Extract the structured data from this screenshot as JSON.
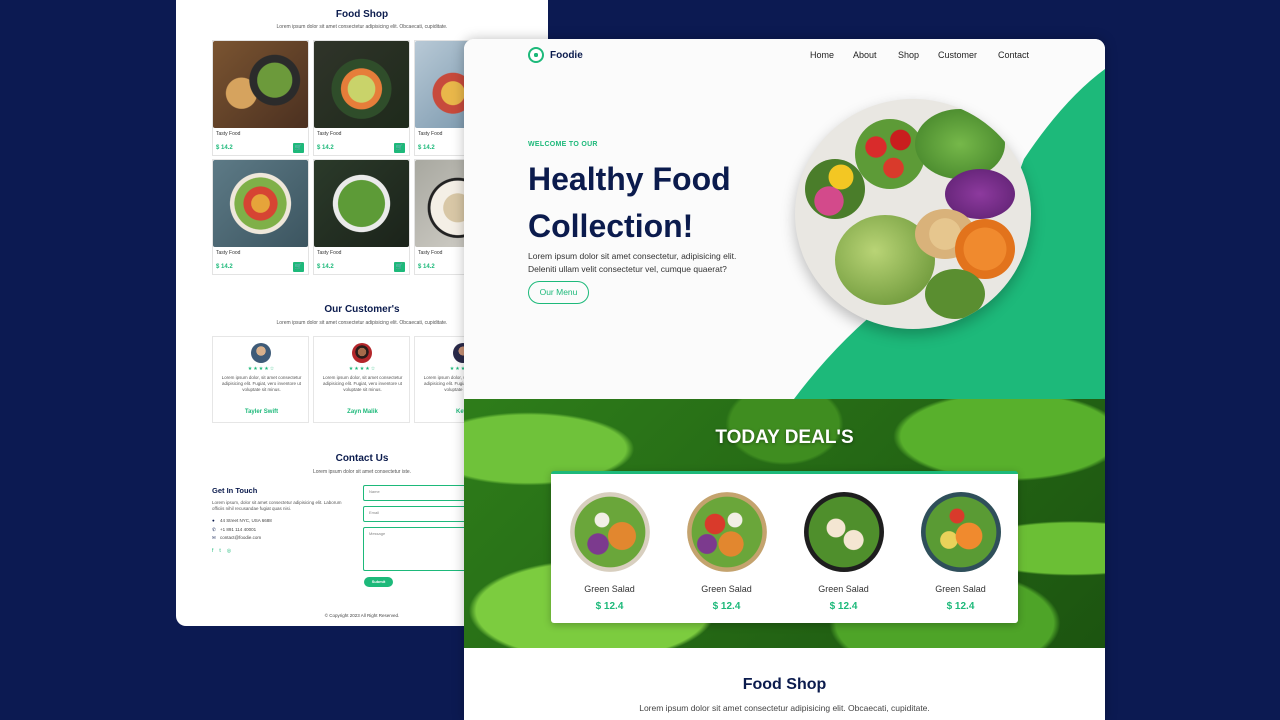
{
  "back": {
    "food_shop": {
      "title": "Food Shop",
      "subtitle": "Lorem ipsum dolor sit amet consectetur adipisicing elit. Obcaecati, cupiditate.",
      "products": [
        {
          "name": "Tasty Food",
          "price": "$ 14.2"
        },
        {
          "name": "Tasty Food",
          "price": "$ 14.2"
        },
        {
          "name": "Tasty Food",
          "price": "$ 14.2"
        },
        {
          "name": "Tasty Food",
          "price": "$ 14.2"
        },
        {
          "name": "Tasty Food",
          "price": "$ 14.2"
        },
        {
          "name": "Tasty Food",
          "price": "$ 14.2"
        }
      ]
    },
    "customers": {
      "title": "Our Customer's",
      "subtitle": "Lorem ipsum dolor sit amet consectetur adipisicing elit. Obcaecati, cupiditate.",
      "stars": "★★★★☆",
      "text": "Lorem ipsum dolor, sit amet consectetur adipisicing elit. Fugiat, vero inventore ut voluptate sit minus.",
      "items": [
        {
          "name": "Tayler Swift"
        },
        {
          "name": "Zayn Malik"
        },
        {
          "name": "Ketty"
        }
      ]
    },
    "contact": {
      "title": "Contact Us",
      "subtitle": "Lorem ipsum dolor sit amet consectetur iste.",
      "get_in_touch": "Get In Touch",
      "intro": "Lorem ipsum, dolor sit amet consectetur adipisicing elit. Laborum officiis nihil recusandae fugiat quas nisi.",
      "address": "44 Street NYC, USA 6688",
      "phone": "+1 891 114 40001",
      "email": "contact@foodie.com",
      "placeholders": {
        "name": "Name",
        "email": "Email",
        "message": "Message"
      },
      "submit": "Submit",
      "social": [
        "f",
        "t",
        "◎"
      ]
    },
    "footer": "© Copyright 2023 All Right Reserved."
  },
  "front": {
    "brand": "Foodie",
    "nav": [
      "Home",
      "About",
      "Shop",
      "Customer",
      "Contact"
    ],
    "hero": {
      "eyebrow": "WELCOME TO OUR",
      "title_line1": "Healthy Food",
      "title_line2": "Collection!",
      "text_line1": "Lorem ipsum dolor sit amet consectetur, adipisicing elit.",
      "text_line2": "Deleniti ullam velit consectetur vel, cumque quaerat?",
      "button": "Our Menu"
    },
    "deals": {
      "title": "TODAY DEAL'S",
      "items": [
        {
          "name": "Green Salad",
          "price": "$ 12.4"
        },
        {
          "name": "Green Salad",
          "price": "$ 12.4"
        },
        {
          "name": "Green Salad",
          "price": "$ 12.4"
        },
        {
          "name": "Green Salad",
          "price": "$ 12.4"
        }
      ]
    },
    "shop": {
      "title": "Food Shop",
      "subtitle": "Lorem ipsum dolor sit amet consectetur adipisicing elit. Obcaecati, cupiditate."
    }
  },
  "colors": {
    "accent": "#1db97a",
    "navy": "#0b1b4d",
    "background": "#0c1a52"
  }
}
